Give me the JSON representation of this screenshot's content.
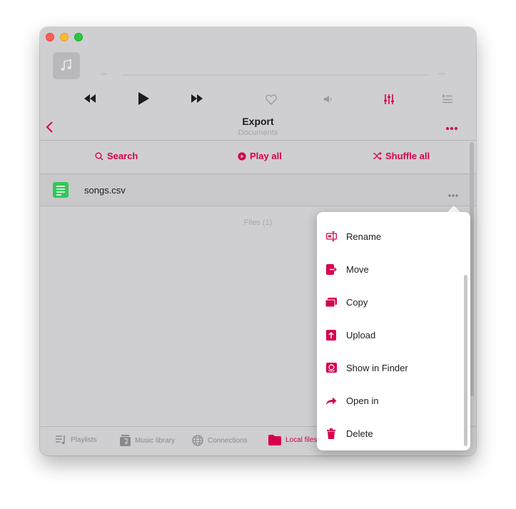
{
  "colors": {
    "accent": "#d6004f",
    "file_green": "#34c759",
    "window_bg": "#cfcfd1"
  },
  "player": {
    "elapsed_placeholder": "--:--",
    "remaining_placeholder": "--:--"
  },
  "nav": {
    "title": "Export",
    "subtitle": "Documents"
  },
  "actions": {
    "search": "Search",
    "play_all": "Play all",
    "shuffle_all": "Shuffle all"
  },
  "file": {
    "name": "songs.csv",
    "icon": "spreadsheet-icon"
  },
  "files_count": "Files (1)",
  "tabs": [
    {
      "label": "Playlists",
      "icon": "playlists-icon"
    },
    {
      "label": "Music library",
      "icon": "music-library-icon"
    },
    {
      "label": "Connections",
      "icon": "globe-icon"
    },
    {
      "label": "Local files",
      "icon": "folder-icon",
      "active": true
    }
  ],
  "menu": [
    {
      "label": "Rename",
      "icon": "rename-icon"
    },
    {
      "label": "Move",
      "icon": "move-icon"
    },
    {
      "label": "Copy",
      "icon": "copy-icon"
    },
    {
      "label": "Upload",
      "icon": "upload-icon"
    },
    {
      "label": "Show in Finder",
      "icon": "finder-icon"
    },
    {
      "label": "Open in",
      "icon": "share-arrow-icon"
    },
    {
      "label": "Delete",
      "icon": "trash-icon"
    }
  ]
}
